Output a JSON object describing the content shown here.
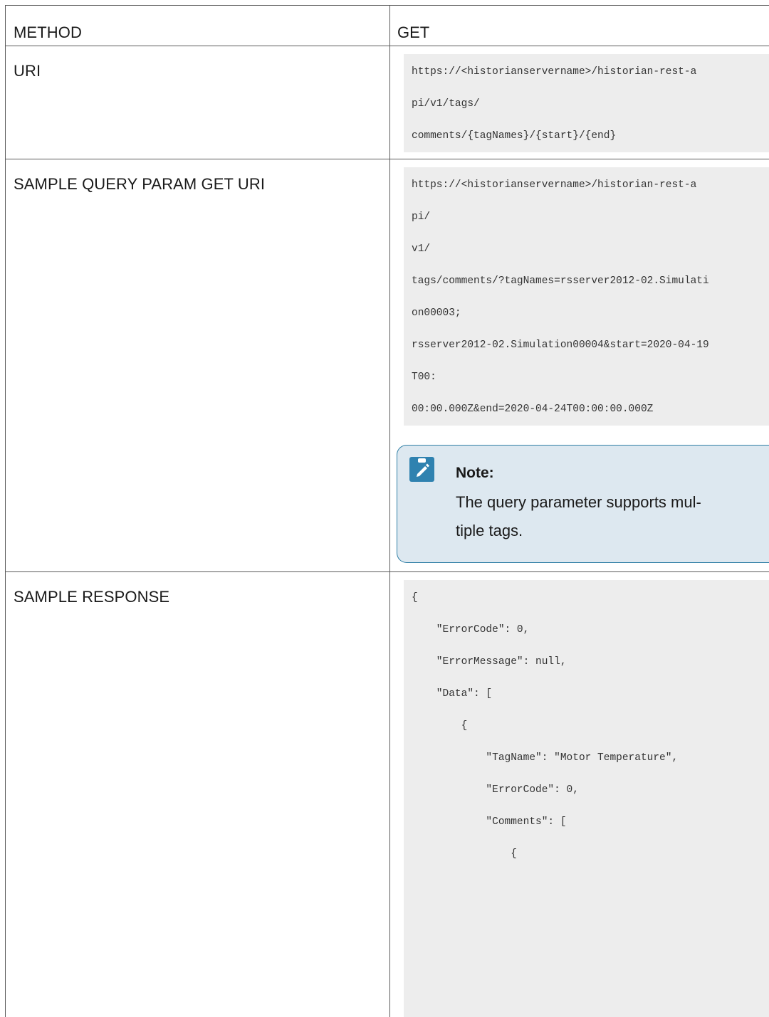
{
  "rows": {
    "method": {
      "label": "METHOD",
      "value": "GET"
    },
    "uri": {
      "label": "URI",
      "code_lines": [
        "https://<historianservername>/historian-rest-a",
        "pi/v1/tags/",
        "comments/{tagNames}/{start}/{end}"
      ]
    },
    "sample_query": {
      "label": "SAMPLE QUERY PARAM GET URI",
      "code_lines": [
        "https://<historianservername>/historian-rest-a",
        "pi/",
        "v1/",
        "tags/comments/?tagNames=rsserver2012-02.Simulati",
        "on00003;",
        "rsserver2012-02.Simulation00004&start=2020-04-19",
        "T00:",
        "00:00.000Z&end=2020-04-24T00:00:00.000Z"
      ],
      "note": {
        "icon": "pencil-icon",
        "title": "Note:",
        "body_lines": [
          "The query parameter supports mul-",
          "tiple tags."
        ]
      }
    },
    "sample_response": {
      "label": "SAMPLE RESPONSE",
      "code_lines": [
        "{",
        "    \"ErrorCode\": 0,",
        "    \"ErrorMessage\": null,",
        "    \"Data\": [",
        "        {",
        "            \"TagName\": \"Motor Temperature\",",
        "            \"ErrorCode\": 0,",
        "            \"Comments\": [",
        "                {"
      ]
    }
  },
  "colors": {
    "note_border": "#2f7fa6",
    "note_bg": "#dde8f0",
    "code_bg": "#ededed"
  }
}
